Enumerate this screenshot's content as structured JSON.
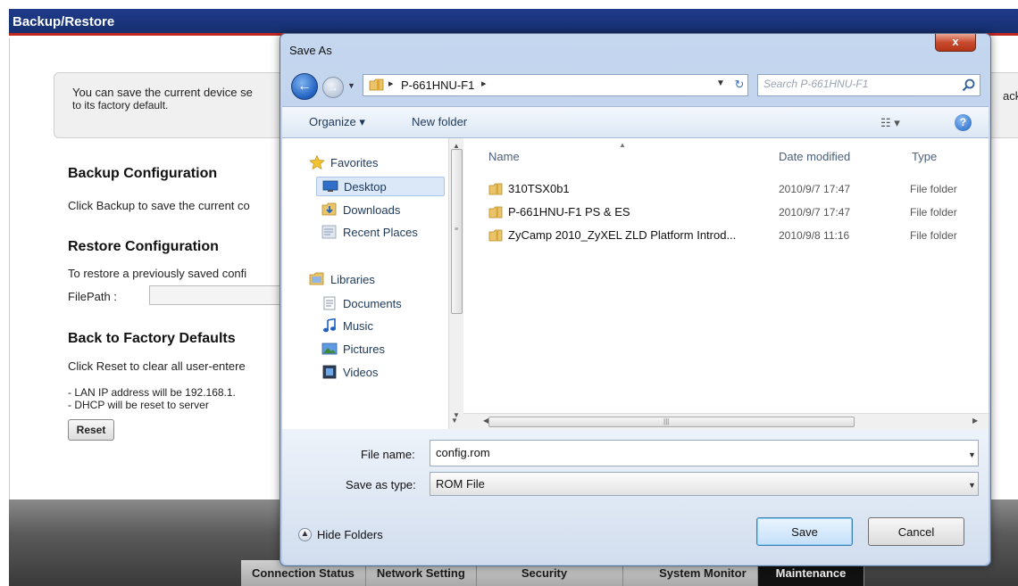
{
  "router": {
    "title": "Backup/Restore",
    "info_line1": "You can save the current device se",
    "info_line2": "to its factory default.",
    "info_right_cut": "ack",
    "backup_title": "Backup Configuration",
    "backup_text": "Click Backup to save the current co",
    "restore_title": "Restore Configuration",
    "restore_text": "To restore a previously saved confi",
    "filepath_label": "FilePath :",
    "factory_title": "Back to Factory Defaults",
    "factory_text": "Click Reset to clear all user-entere",
    "lan_text": "- LAN IP address will be 192.168.1.",
    "dhcp_text": "- DHCP will be reset to server",
    "reset_label": "Reset",
    "nav": [
      {
        "label": "Connection Status",
        "active": false
      },
      {
        "label": "Network Setting",
        "active": false
      },
      {
        "label": "Security",
        "active": false
      },
      {
        "label": "System Monitor",
        "active": false
      },
      {
        "label": "Maintenance",
        "active": true
      }
    ]
  },
  "dialog": {
    "title": "Save As",
    "close_label": "x",
    "address": {
      "path": "P-661HNU-F1",
      "search_placeholder": "Search P-661HNU-F1"
    },
    "toolbar": {
      "organize_label": "Organize ▾",
      "new_folder_label": "New folder",
      "views_label": "☷ ▾",
      "help_label": "?"
    },
    "nav_pane": {
      "favorites_label": "Favorites",
      "favorites": [
        {
          "label": "Desktop",
          "icon": "desktop-icon",
          "selected": true
        },
        {
          "label": "Downloads",
          "icon": "downloads-icon",
          "selected": false
        },
        {
          "label": "Recent Places",
          "icon": "recent-places-icon",
          "selected": false
        }
      ],
      "libraries_label": "Libraries",
      "libraries": [
        {
          "label": "Documents",
          "icon": "documents-icon"
        },
        {
          "label": "Music",
          "icon": "music-icon"
        },
        {
          "label": "Pictures",
          "icon": "pictures-icon"
        },
        {
          "label": "Videos",
          "icon": "videos-icon"
        }
      ]
    },
    "columns": {
      "name": "Name",
      "date_modified": "Date modified",
      "type": "Type"
    },
    "files": [
      {
        "name": "310TSX0b1",
        "date": "2010/9/7 17:47",
        "type": "File folder"
      },
      {
        "name": "P-661HNU-F1 PS & ES",
        "date": "2010/9/7 17:47",
        "type": "File folder"
      },
      {
        "name": "ZyCamp 2010_ZyXEL ZLD Platform Introd...",
        "date": "2010/9/8 11:16",
        "type": "File folder"
      }
    ],
    "form": {
      "file_name_label": "File name:",
      "file_name_value": "config.rom",
      "save_type_label": "Save as type:",
      "save_type_value": "ROM File"
    },
    "hide_folders_label": "Hide Folders",
    "save_label": "Save",
    "cancel_label": "Cancel"
  },
  "colors": {
    "router_title_bg": "#1f3a8a",
    "router_accent": "#c0281f",
    "dialog_frame": "#b4c9e8",
    "close_button": "#c94a2e"
  }
}
